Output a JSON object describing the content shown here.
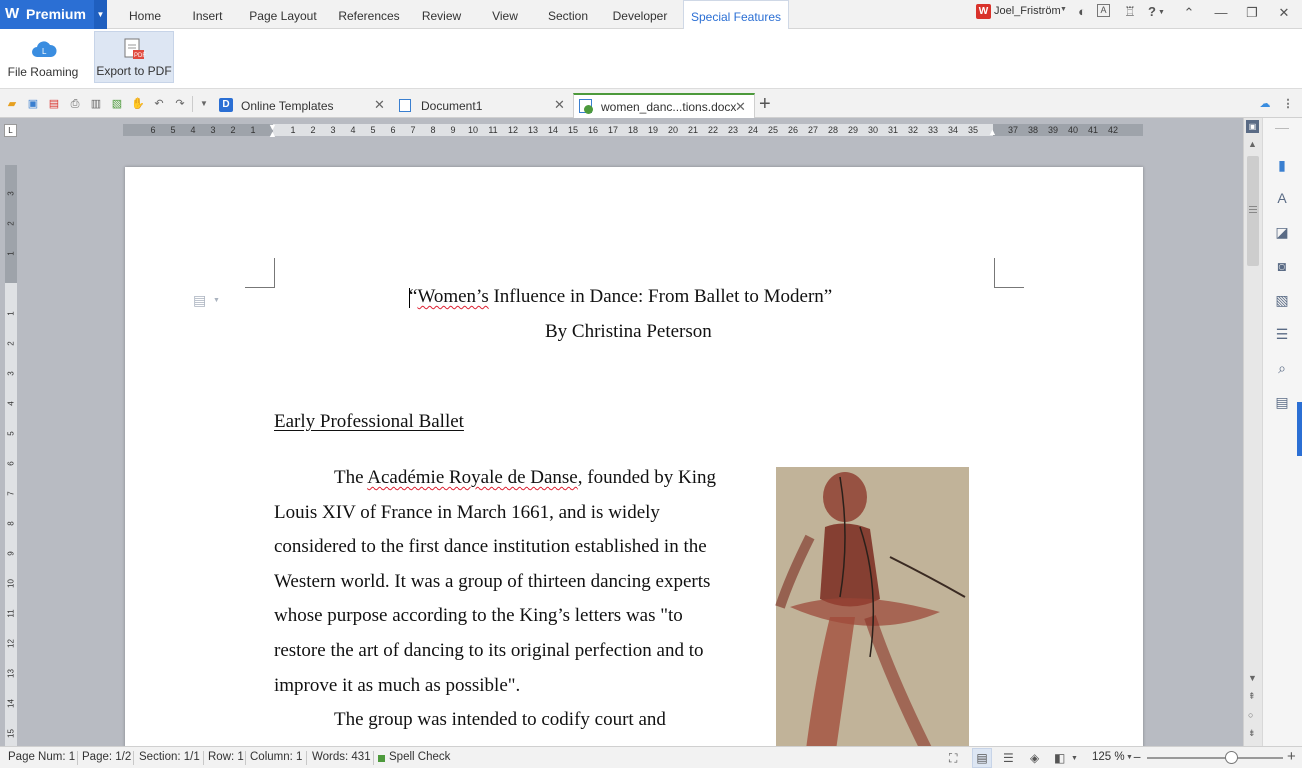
{
  "app": {
    "premium_label": "Premium",
    "logo_letter": "W"
  },
  "menu": {
    "tabs": [
      "Home",
      "Insert",
      "Page Layout",
      "References",
      "Review",
      "View",
      "Section",
      "Developer",
      "Special Features"
    ],
    "active_tab": "Special Features",
    "user_name": "Joel_Friström",
    "help": "?"
  },
  "ribbon": {
    "file_roaming": "File Roaming",
    "export_pdf": "Export to PDF"
  },
  "tabs": {
    "online_templates": "Online Templates",
    "document1": "Document1",
    "active_doc": "women_danc...tions.docx",
    "close_glyph": "✕",
    "new_tab_glyph": "+"
  },
  "ruler": {
    "h_left": [
      "6",
      "5",
      "4",
      "3",
      "2",
      "1"
    ],
    "h_right": [
      "1",
      "2",
      "3",
      "4",
      "5",
      "6",
      "7",
      "8",
      "9",
      "10",
      "11",
      "12",
      "13",
      "14",
      "15",
      "16",
      "17",
      "18",
      "19",
      "20",
      "21",
      "22",
      "23",
      "24",
      "25",
      "26",
      "27",
      "28",
      "29",
      "30",
      "31",
      "32",
      "33",
      "34",
      "35",
      "",
      "37",
      "38",
      "39",
      "40",
      "41",
      "42"
    ],
    "v_top": [
      "3",
      "2",
      "1"
    ],
    "v_main": [
      "1",
      "2",
      "3",
      "4",
      "5",
      "6",
      "7",
      "8",
      "9",
      "10",
      "11",
      "12",
      "13",
      "14",
      "15"
    ],
    "corner": "L"
  },
  "document": {
    "title": "“Women’s Influence in Dance: From Ballet to Modern”",
    "title_squiggle": "Women’s",
    "title_rest": " Influence in Dance: From Ballet to Modern”",
    "title_open": "“",
    "byline": "By Christina Peterson",
    "heading": "Early Professional Ballet",
    "para1": [
      {
        "pre": "The ",
        "sq": "Académie Royale de Danse",
        "post": ", founded by King"
      },
      {
        "pre": "Louis XIV of France in March 1661, and is widely",
        "sq": "",
        "post": ""
      },
      {
        "pre": "considered to the first dance institution established in the",
        "sq": "",
        "post": ""
      },
      {
        "pre": "Western world. It was a group of thirteen dancing experts",
        "sq": "",
        "post": ""
      },
      {
        "pre": "whose purpose according to the King’s letters was \"to",
        "sq": "",
        "post": ""
      },
      {
        "pre": "restore the art of dancing to its original perfection and to",
        "sq": "",
        "post": ""
      },
      {
        "pre": "improve it as much as possible\".",
        "sq": "",
        "post": ""
      }
    ],
    "para2_line1": "The group was intended to codify court and"
  },
  "status": {
    "page_num": "Page Num: 1",
    "page": "Page: 1/2",
    "section": "Section: 1/1",
    "row": "Row: 1",
    "column": "Column: 1",
    "words": "Words: 431",
    "spell_check": "Spell Check",
    "zoom": "125 %",
    "zoom_level": 0.62
  },
  "colors": {
    "brand_blue": "#2b6fd4",
    "active_tab_text": "#2b6fd4",
    "doc_tab_green": "#4d9a3c"
  }
}
